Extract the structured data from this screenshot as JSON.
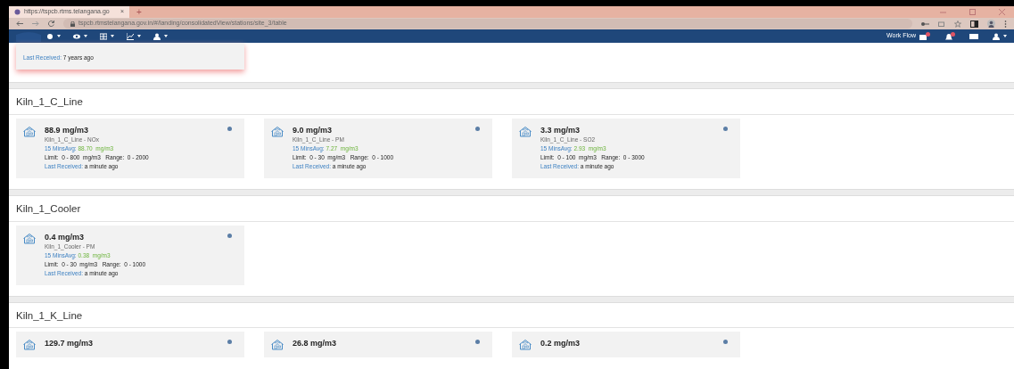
{
  "browser": {
    "tab_title": "https://tspcb.rtms.telangana.go",
    "tab_close": "×",
    "new_tab": "+",
    "url": "tspcb.rtmstelangana.gov.in/#/landing/consolidatedView/stations/site_3/table"
  },
  "navbar": {
    "workflow_label": "Work Flow"
  },
  "top_card": {
    "alert": true,
    "last_received_label": "Last Received:",
    "last_received": "7 years ago"
  },
  "sections": [
    {
      "title": "Kiln_1_C_Line",
      "cards": [
        {
          "value": "88.9 mg/m3",
          "name": "Kiln_1_C_Line - NOx",
          "avg_label": "15 MinsAvg:",
          "avg": "88.70  mg/m3",
          "limit": "Limit:  0 - 800  mg/m3   Range:  0 - 2000",
          "last_received_label": "Last Received:",
          "last_received": "a minute ago",
          "color": "#5b7ea6"
        },
        {
          "value": "9.0 mg/m3",
          "name": "Kiln_1_C_Line - PM",
          "avg_label": "15 MinsAvg:",
          "avg": "7.27  mg/m3",
          "limit": "Limit:  0 - 30  mg/m3   Range:  0 - 1000",
          "last_received_label": "Last Received:",
          "last_received": "a minute ago",
          "color": "#5b7ea6"
        },
        {
          "value": "3.3 mg/m3",
          "name": "Kiln_1_C_Line - SO2",
          "avg_label": "15 MinsAvg:",
          "avg": "2.93  mg/m3",
          "limit": "Limit:  0 - 100  mg/m3   Range:  0 - 3000",
          "last_received_label": "Last Received:",
          "last_received": "a minute ago",
          "color": "#5b7ea6"
        }
      ]
    },
    {
      "title": "Kiln_1_Cooler",
      "cards": [
        {
          "value": "0.4 mg/m3",
          "name": "Kiln_1_Cooler - PM",
          "avg_label": "15 MinsAvg:",
          "avg": "0.38  mg/m3",
          "limit": "Limit:  0 - 30  mg/m3   Range:  0 - 1000",
          "last_received_label": "Last Received:",
          "last_received": "a minute ago",
          "color": "#5b7ea6"
        }
      ]
    },
    {
      "title": "Kiln_1_K_Line",
      "cards": [
        {
          "value": "129.7 mg/m3",
          "color": "#5b7ea6"
        },
        {
          "value": "26.8 mg/m3",
          "color": "#5b7ea6"
        },
        {
          "value": "0.2 mg/m3",
          "color": "#5b7ea6"
        }
      ]
    }
  ]
}
